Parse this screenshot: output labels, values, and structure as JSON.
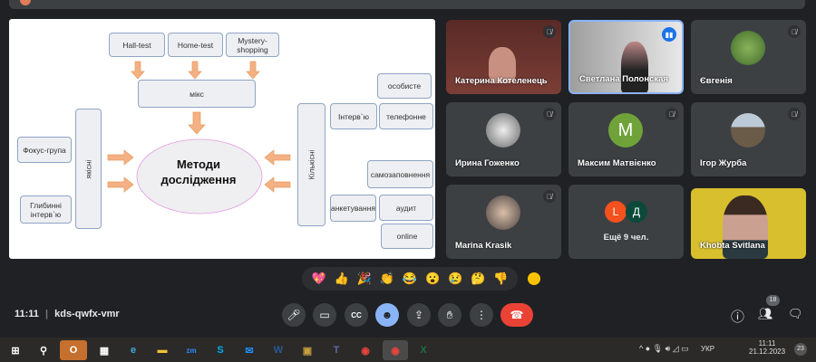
{
  "slide": {
    "top_boxes": [
      "Hall-test",
      "Home-test",
      "Mystery-shopping"
    ],
    "mix": "мікс",
    "center": [
      "Методи",
      "дослідження"
    ],
    "qualitative": "якісні",
    "qual_items": [
      "Фокус-група",
      "Глибинні інтерв`ю"
    ],
    "quantitative": "Кількісні",
    "interview": "Інтерв`ю",
    "interview_items": [
      "особисте",
      "телефонне"
    ],
    "self_fill": "самозаповнення",
    "survey": "анкетування",
    "survey_items": [
      "аудит",
      "online"
    ],
    "colors": {
      "arrow": "#f4b183",
      "box_border": "#8fa4c4",
      "ellipse_border": "#e39be0"
    }
  },
  "participants": [
    {
      "name": "Катерина Котеленець",
      "muted": true
    },
    {
      "name": "Светлана Полонская",
      "speaking": true
    },
    {
      "name": "Євгенія",
      "muted": true
    },
    {
      "name": "Ирина Гоженко",
      "muted": true
    },
    {
      "name": "Максим Матвієнко",
      "initial": "M",
      "muted": true,
      "color": "#6fa33a"
    },
    {
      "name": "Ігор Журба",
      "muted": true
    },
    {
      "name": "Marina Krasik",
      "muted": true
    },
    {
      "name": "Ещё 9 чел.",
      "initials": [
        "L",
        "Д"
      ]
    },
    {
      "name": "Khobta Svitlana"
    }
  ],
  "reactions": [
    "💖",
    "👍",
    "🎉",
    "👏",
    "😂",
    "😮",
    "😢",
    "🤔",
    "👎"
  ],
  "meeting": {
    "time": "11:11",
    "code": "kds-qwfx-vmr",
    "participant_count": "18"
  },
  "taskbar": {
    "lang": "УКР",
    "time": "11:11",
    "date": "21.12.2023",
    "notifications": "23",
    "apps": [
      "Outlook",
      "Store",
      "Edge",
      "Explorer",
      "Zoom",
      "Skype",
      "Mail",
      "Word",
      "Presentation",
      "Teams",
      "Chrome",
      "Chrome",
      "Excel"
    ]
  }
}
